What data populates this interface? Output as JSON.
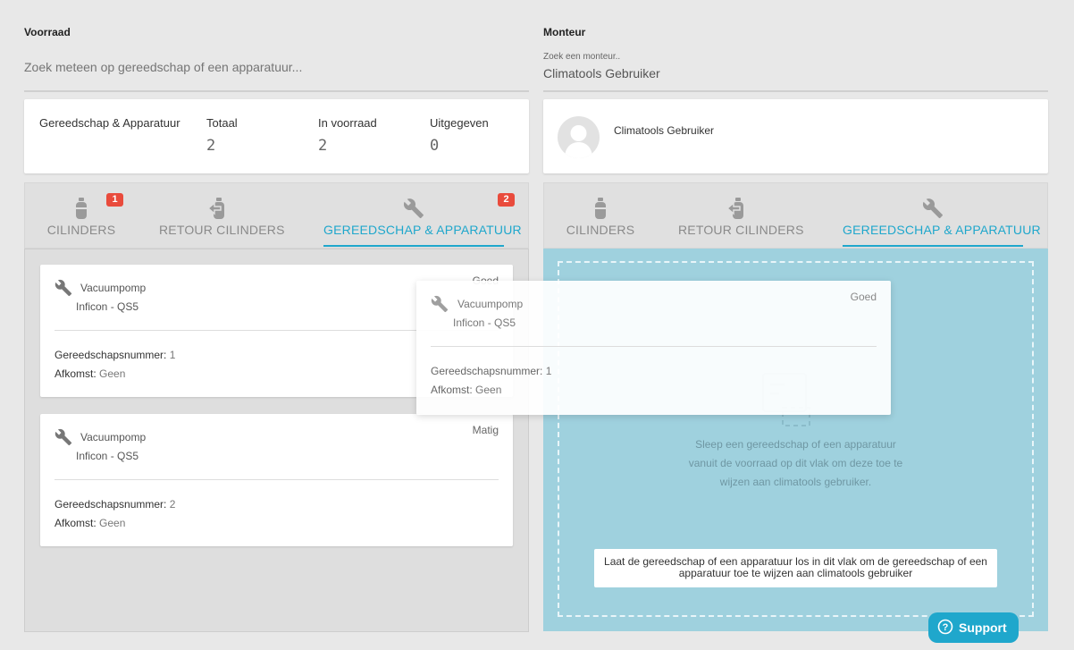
{
  "voorraad": {
    "title": "Voorraad",
    "search_placeholder": "Zoek meteen op gereedschap of een apparatuur...",
    "stats": {
      "name_label": "Gereedschap & Apparatuur",
      "totaal_label": "Totaal",
      "totaal_value": "2",
      "in_voorraad_label": "In voorraad",
      "in_voorraad_value": "2",
      "uitgegeven_label": "Uitgegeven",
      "uitgegeven_value": "0"
    },
    "tabs": [
      {
        "label": "CILINDERS",
        "icon": "cylinder-icon",
        "badge": "1"
      },
      {
        "label": "RETOUR CILINDERS",
        "icon": "return-icon",
        "badge": ""
      },
      {
        "label": "GEREEDSCHAP & APPARATUUR",
        "icon": "wrench-icon",
        "badge": "2",
        "active": true
      }
    ],
    "items": [
      {
        "name": "Vacuumpomp",
        "model": "Inficon - QS5",
        "condition": "Goed",
        "number_label": "Gereedschapsnummer:",
        "number": "1",
        "origin_label": "Afkomst:",
        "origin": "Geen"
      },
      {
        "name": "Vacuumpomp",
        "model": "Inficon - QS5",
        "condition": "Matig",
        "number_label": "Gereedschapsnummer:",
        "number": "2",
        "origin_label": "Afkomst:",
        "origin": "Geen"
      }
    ]
  },
  "monteur": {
    "title": "Monteur",
    "search_label": "Zoek een monteur..",
    "search_value": "Climatools Gebruiker",
    "user_name": "Climatools Gebruiker",
    "tabs": [
      {
        "label": "CILINDERS",
        "icon": "cylinder-icon"
      },
      {
        "label": "RETOUR CILINDERS",
        "icon": "return-icon"
      },
      {
        "label": "GEREEDSCHAP & APPARATUUR",
        "icon": "wrench-icon",
        "active": true
      }
    ],
    "drop_text_1": "Sleep een gereedschap of een apparatuur",
    "drop_text_2": "vanuit de voorraad op dit vlak om deze toe te",
    "drop_text_3": "wijzen aan climatools gebruiker.",
    "drop_hint_1": "Laat de gereedschap of een apparatuur los in dit vlak om de gereedschap of een",
    "drop_hint_2": "apparatuur toe te wijzen aan climatools gebruiker"
  },
  "dragging": {
    "name": "Vacuumpomp",
    "model": "Inficon - QS5",
    "condition": "Goed",
    "number_label": "Gereedschapsnummer:",
    "number": "1",
    "origin_label": "Afkomst:",
    "origin": "Geen"
  },
  "support": {
    "label": "Support"
  },
  "colors": {
    "accent": "#1fa7cc",
    "badge": "#e94b3c",
    "dropzone": "#9fd1de"
  }
}
